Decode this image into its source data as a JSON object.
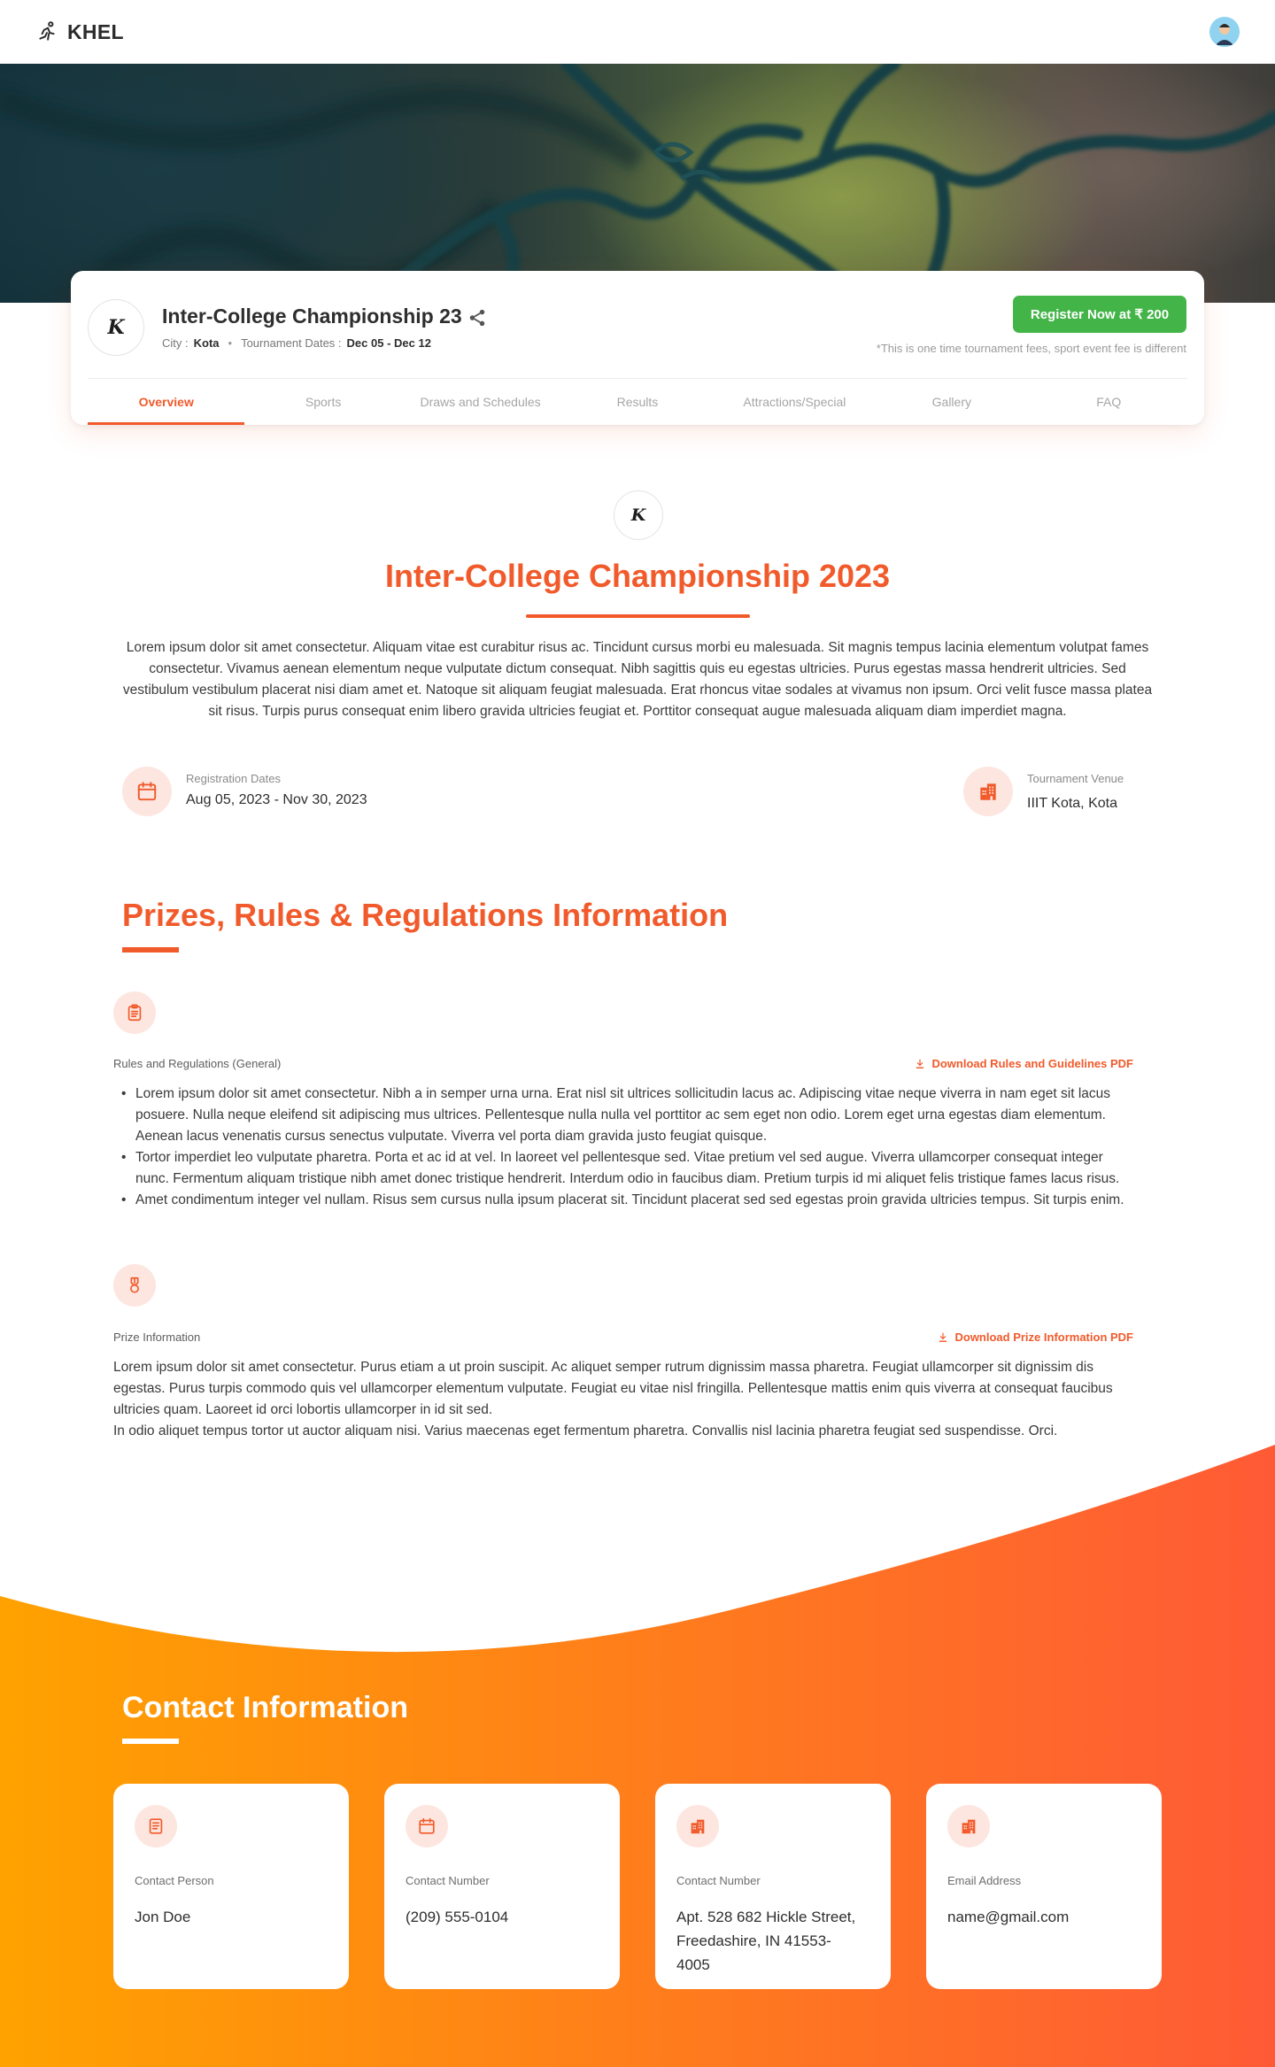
{
  "header": {
    "brand_name": "KHEL"
  },
  "event": {
    "title": "Inter-College Championship 23",
    "city_label": "City :",
    "city": "Kota",
    "dates_label": "Tournament Dates :",
    "dates": "Dec 05 - Dec 12",
    "register_label": "Register Now at ₹ 200",
    "fee_note": "*This is one time tournament fees, sport event fee is different",
    "logo_letter": "K"
  },
  "tabs": [
    {
      "label": "Overview"
    },
    {
      "label": "Sports"
    },
    {
      "label": "Draws and Schedules"
    },
    {
      "label": "Results"
    },
    {
      "label": "Attractions/Special"
    },
    {
      "label": "Gallery"
    },
    {
      "label": "FAQ"
    }
  ],
  "overview": {
    "title": "Inter-College Championship 2023",
    "description": "Lorem ipsum dolor sit amet consectetur. Aliquam vitae est curabitur risus ac. Tincidunt cursus morbi eu malesuada. Sit magnis tempus lacinia elementum volutpat fames consectetur. Vivamus aenean elementum neque vulputate dictum consequat. Nibh sagittis quis eu egestas ultricies. Purus egestas massa hendrerit ultricies. Sed vestibulum vestibulum placerat nisi diam amet et. Natoque sit aliquam feugiat malesuada. Erat rhoncus vitae sodales at vivamus non ipsum. Orci velit fusce massa platea sit risus. Turpis purus consequat enim libero gravida ultricies feugiat et. Porttitor consequat augue malesuada aliquam diam imperdiet magna.",
    "registration_label": "Registration Dates",
    "registration_value": "Aug 05, 2023 - Nov 30, 2023",
    "venue_label": "Tournament Venue",
    "venue_value": "IIIT Kota, Kota"
  },
  "prizes": {
    "title": "Prizes, Rules & Regulations Information",
    "rules_label": "Rules and Regulations (General)",
    "rules_download": "Download Rules and Guidelines PDF",
    "rules": [
      "Lorem ipsum dolor sit amet consectetur. Nibh a in semper urna urna. Erat nisl sit ultrices sollicitudin lacus ac. Adipiscing vitae neque viverra in nam eget sit lacus posuere. Nulla neque eleifend sit adipiscing mus ultrices. Pellentesque nulla nulla vel porttitor ac sem eget non odio. Lorem eget urna egestas diam elementum. Aenean lacus venenatis cursus senectus vulputate. Viverra vel porta diam gravida justo feugiat quisque.",
      "Tortor imperdiet leo vulputate pharetra. Porta et ac id at vel. In laoreet vel pellentesque sed. Vitae pretium vel sed augue. Viverra ullamcorper consequat integer nunc. Fermentum aliquam tristique nibh amet donec tristique hendrerit. Interdum odio in faucibus diam. Pretium turpis id mi aliquet felis tristique fames lacus risus.",
      "Amet condimentum integer vel nullam. Risus sem cursus nulla ipsum placerat sit. Tincidunt placerat sed sed egestas proin gravida ultricies tempus. Sit turpis enim."
    ],
    "prize_label": "Prize Information",
    "prize_download": "Download Prize Information PDF",
    "prize_text_1": "Lorem ipsum dolor sit amet consectetur. Purus etiam a ut proin suscipit. Ac aliquet semper rutrum dignissim massa pharetra. Feugiat ullamcorper sit dignissim dis egestas. Purus turpis commodo quis vel ullamcorper elementum vulputate. Feugiat eu vitae nisl fringilla. Pellentesque mattis enim quis viverra at consequat faucibus ultricies quam. Laoreet id orci lobortis ullamcorper in id sit sed.",
    "prize_text_2": "In odio aliquet tempus tortor ut auctor aliquam nisi. Varius maecenas eget fermentum pharetra. Convallis nisl lacinia pharetra feugiat sed suspendisse. Orci."
  },
  "contact": {
    "title": "Contact Information",
    "cards": [
      {
        "label": "Contact Person",
        "value": "Jon Doe",
        "icon": "document-icon"
      },
      {
        "label": "Contact Number",
        "value": "(209) 555-0104",
        "icon": "calendar-icon"
      },
      {
        "label": "Contact Number",
        "value": "Apt. 528 682 Hickle Street, Freedashire, IN 41553-4005",
        "icon": "building-icon"
      },
      {
        "label": "Email Address",
        "value": "name@gmail.com",
        "icon": "building-icon"
      }
    ]
  },
  "colors": {
    "accent": "#f15a2b",
    "register_green": "#43b548",
    "icon_bg": "#fde6df",
    "gradient_start": "#ffa200",
    "gradient_end": "#ff5a36"
  }
}
